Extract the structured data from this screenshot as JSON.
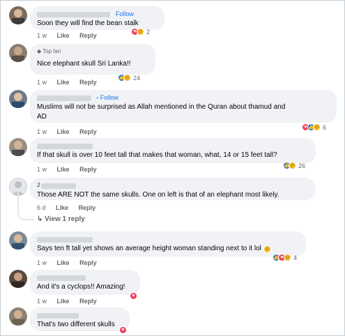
{
  "comments": [
    {
      "text": "Soon they will find the bean stalk",
      "follow": "Follow",
      "time": "1 w",
      "like": "Like",
      "reply": "Reply",
      "react_count": "2"
    },
    {
      "badge": "Top fan",
      "text": "Nice elephant skull Sri Lanka!!",
      "time": "1 w",
      "like": "Like",
      "reply": "Reply",
      "react_count": "24"
    },
    {
      "follow": "Follow",
      "text_line1": "Muslims will not be surprised as Allah mentioned in the Quran about thamud and",
      "text_line2": "AD",
      "time": "1 w",
      "like": "Like",
      "reply": "Reply",
      "react_count": "6"
    },
    {
      "text": "If that skull is over 10 feet tall that makes that woman, what, 14 or 15 feet tall?",
      "time": "1 w",
      "like": "Like",
      "reply": "Reply",
      "react_count": "26"
    },
    {
      "name_initial": "J",
      "text": "Those ARE NOT the same skulls. One on left is that of an elephant most likely.",
      "time": "6 d",
      "like": "Like",
      "reply": "Reply",
      "view_replies": "View 1 reply"
    },
    {
      "text": "Says ten ft tall yet shows an average height woman standing next to it lol",
      "time": "1 w",
      "like": "Like",
      "reply": "Reply",
      "react_count": "4"
    },
    {
      "text": "And it's a cyclops!! Amazing!",
      "time": "1 w",
      "like": "Like",
      "reply": "Reply"
    },
    {
      "text": "That's two different skulls"
    }
  ],
  "icons": {
    "like": "like-reaction-icon",
    "love": "love-reaction-icon",
    "haha": "haha-reaction-icon",
    "top_fan": "diamond-icon",
    "reply_arrow": "reply-arrow-icon"
  },
  "colors": {
    "link": "#1877f2",
    "bubble": "#f0f2f5",
    "meta": "#65676b",
    "like_blue": "#1b74e4",
    "love_red": "#f33e58",
    "haha_yellow": "#f7b928"
  }
}
